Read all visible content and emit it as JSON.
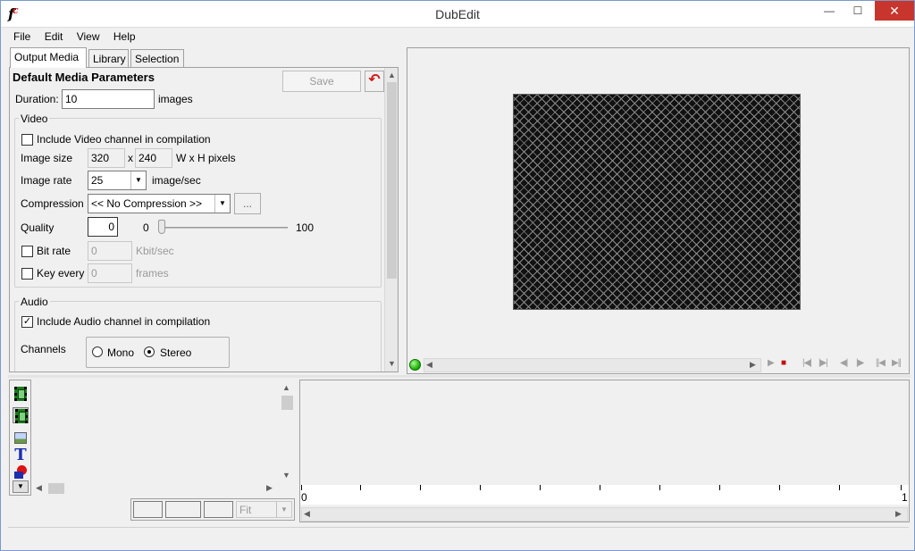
{
  "window": {
    "title": "DubEdit",
    "minimize": "—",
    "maximize": "☐",
    "close": "✕"
  },
  "menu": [
    "File",
    "Edit",
    "View",
    "Help"
  ],
  "tabs": [
    "Output Media",
    "Library",
    "Selection"
  ],
  "params": {
    "heading": "Default Media Parameters",
    "save_label": "Save",
    "duration_label": "Duration:",
    "duration_value": "10",
    "duration_unit": "images"
  },
  "video": {
    "group_label": "Video",
    "include_label": "Include Video channel in compilation",
    "include_checked": false,
    "image_size_label": "Image size",
    "width": "320",
    "x_sep": "x",
    "height": "240",
    "size_unit": "W x H pixels",
    "image_rate_label": "Image rate",
    "image_rate_value": "25",
    "rate_unit": "image/sec",
    "compression_label": "Compression",
    "compression_value": "<< No Compression >>",
    "compression_button": "...",
    "quality_label": "Quality",
    "quality_value": "0",
    "quality_min": "0",
    "quality_max": "100",
    "quality_level": 0,
    "bitrate_label": "Bit rate",
    "bitrate_value": "0",
    "bitrate_unit": "Kbit/sec",
    "keyevery_label": "Key every",
    "keyevery_value": "0",
    "keyevery_unit": "frames"
  },
  "audio": {
    "group_label": "Audio",
    "include_label": "Include Audio channel in compilation",
    "include_checked": true,
    "channels_label": "Channels",
    "mono_label": "Mono",
    "stereo_label": "Stereo",
    "selected": "Stereo"
  },
  "bottom": {
    "zoom_value": "Fit"
  },
  "timeline": {
    "ruler_start": "0",
    "ruler_end": "1"
  },
  "icons": {
    "app": "dubedit-logo-icon",
    "undo": "undo-arrow-icon",
    "status": "green-led-icon",
    "tools": [
      "video-clip-icon",
      "video-clip-icon",
      "image-icon",
      "text-icon",
      "shapes-icon"
    ]
  },
  "colors": {
    "accent_close": "#c7352c",
    "status_green": "#14a800",
    "undo_red": "#d01818"
  }
}
